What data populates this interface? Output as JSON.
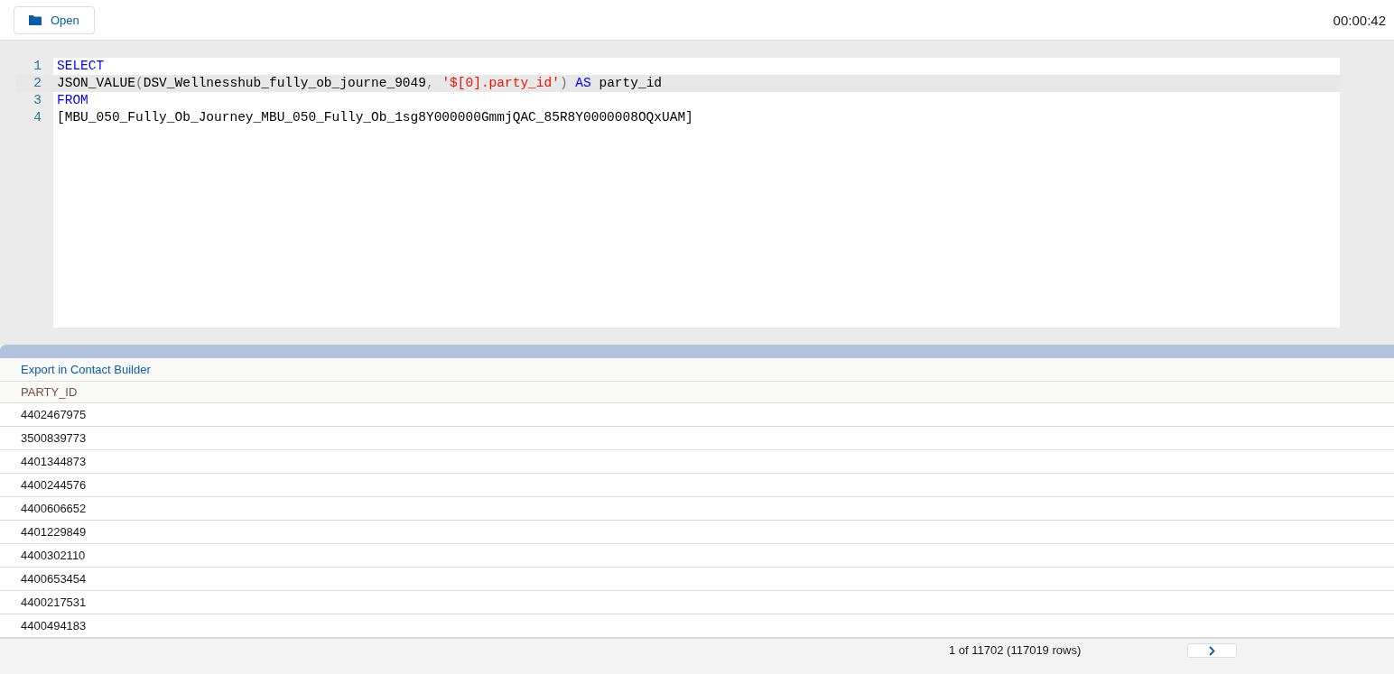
{
  "toolbar": {
    "open_button": "Open",
    "timer": "00:00:42"
  },
  "editor": {
    "lines": [
      {
        "number": "1",
        "selected": false,
        "tokens": [
          {
            "kind": "keyword",
            "text": "SELECT"
          }
        ]
      },
      {
        "number": "2",
        "selected": true,
        "tokens": [
          {
            "kind": "plain",
            "text": "JSON_VALUE"
          },
          {
            "kind": "punct",
            "text": "("
          },
          {
            "kind": "plain",
            "text": "DSV_Wellnesshub_fully_ob_journe_9049"
          },
          {
            "kind": "punct",
            "text": ", "
          },
          {
            "kind": "string",
            "text": "'$[0].party_id'"
          },
          {
            "kind": "punct",
            "text": ") "
          },
          {
            "kind": "keyword",
            "text": "AS"
          },
          {
            "kind": "plain",
            "text": " party_id"
          }
        ]
      },
      {
        "number": "3",
        "selected": false,
        "tokens": [
          {
            "kind": "keyword",
            "text": "FROM"
          }
        ]
      },
      {
        "number": "4",
        "selected": false,
        "tokens": [
          {
            "kind": "plain",
            "text": "[MBU_050_Fully_Ob_Journey_MBU_050_Fully_Ob_1sg8Y000000GmmjQAC_85R8Y0000008OQxUAM]"
          }
        ]
      }
    ]
  },
  "results": {
    "export_link": "Export in Contact Builder",
    "columns": [
      "PARTY_ID"
    ],
    "rows": [
      [
        "4402467975"
      ],
      [
        "3500839773"
      ],
      [
        "4401344873"
      ],
      [
        "4400244576"
      ],
      [
        "4400606652"
      ],
      [
        "4401229849"
      ],
      [
        "4400302110"
      ],
      [
        "4400653454"
      ],
      [
        "4400217531"
      ],
      [
        "4400494183"
      ]
    ],
    "pager": "1 of 11702 (117019 rows)"
  }
}
